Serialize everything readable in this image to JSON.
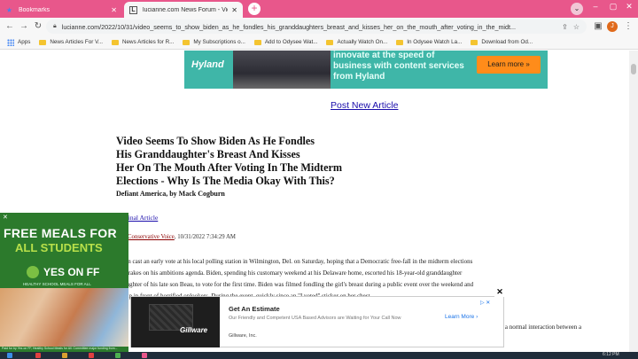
{
  "browser": {
    "tabs": [
      {
        "title": "Bookmarks",
        "icon": "star-icon",
        "active": false
      },
      {
        "title": "lucianne.com News Forum - Vid...",
        "icon": "lucianne-icon",
        "active": true
      }
    ],
    "url": "lucianne.com/2022/10/31/video_seems_to_show_biden_as_he_fondles_his_granddaughters_breast_and_kisses_her_on_the_mouth_after_voting_in_the_midt...",
    "profile_initial": "J",
    "bookmarks": [
      {
        "label": "Apps",
        "type": "apps"
      },
      {
        "label": "News Articles For V...",
        "type": "folder"
      },
      {
        "label": "News Articles for R...",
        "type": "folder"
      },
      {
        "label": "My Subscriptions o...",
        "type": "folder"
      },
      {
        "label": "Add to Odysee Wat...",
        "type": "folder"
      },
      {
        "label": "Actually Watch On...",
        "type": "folder"
      },
      {
        "label": "In Odysee Watch La...",
        "type": "folder"
      },
      {
        "label": "Download from Od...",
        "type": "folder"
      }
    ]
  },
  "top_ad": {
    "logo": "Hyland",
    "copy": "innovate at the speed of business with content services from Hyland",
    "cta": "Learn more »"
  },
  "page": {
    "post_link": "Post New Article",
    "title_lines": [
      "Video Seems To Show Biden As He Fondles",
      "His Granddaughter's Breast And Kisses",
      "Her On The Mouth After Voting In The Midterm",
      "Elections - Why Is The Media Okay With This?"
    ],
    "byline": "Defiant America, by Mack Cogburn",
    "original_link": "Original Article",
    "source_link": "lack Conservative Voice",
    "timestamp": ", 10/31/2022 7:34:29 AM",
    "body_lines": [
      "Biden cast an early vote at his local polling station in Wilmington, Del. on Saturday, hoping that a Democratic free-fall in the midterm elections",
      "the brakes on his ambitions agenda. Biden, spending his customary weekend at his Delaware home, escorted his 18-year-old granddaughter",
      "e daughter of his late son Beau, to vote for the first time. Biden was filmed fondling the girl's breast during a public event over the weekend and",
      "her lip in front of horrified onlookers. During the event, quickly since an \"I voted\" sticker on her chest"
    ],
    "body_tail": "e a normal interaction between a"
  },
  "left_ad": {
    "headline1": "FREE MEALS FOR",
    "headline2": "ALL STUDENTS",
    "yes": "YES ON FF",
    "sub": "HEALTHY SCHOOL MEALS FOR ALL",
    "disclaimer": "Paid for by Yes on FF, Healthy School Meals for All. Committee major funding from..."
  },
  "bottom_ad": {
    "title": "Get An Estimate",
    "description": "Our Friendly and Competent USA Based Advisors are Waiting for Your Call Now",
    "advertiser": "Gillware, Inc.",
    "brand": "Gillware",
    "cta": "Learn More"
  },
  "taskbar": {
    "clock": "6:12 PM"
  }
}
